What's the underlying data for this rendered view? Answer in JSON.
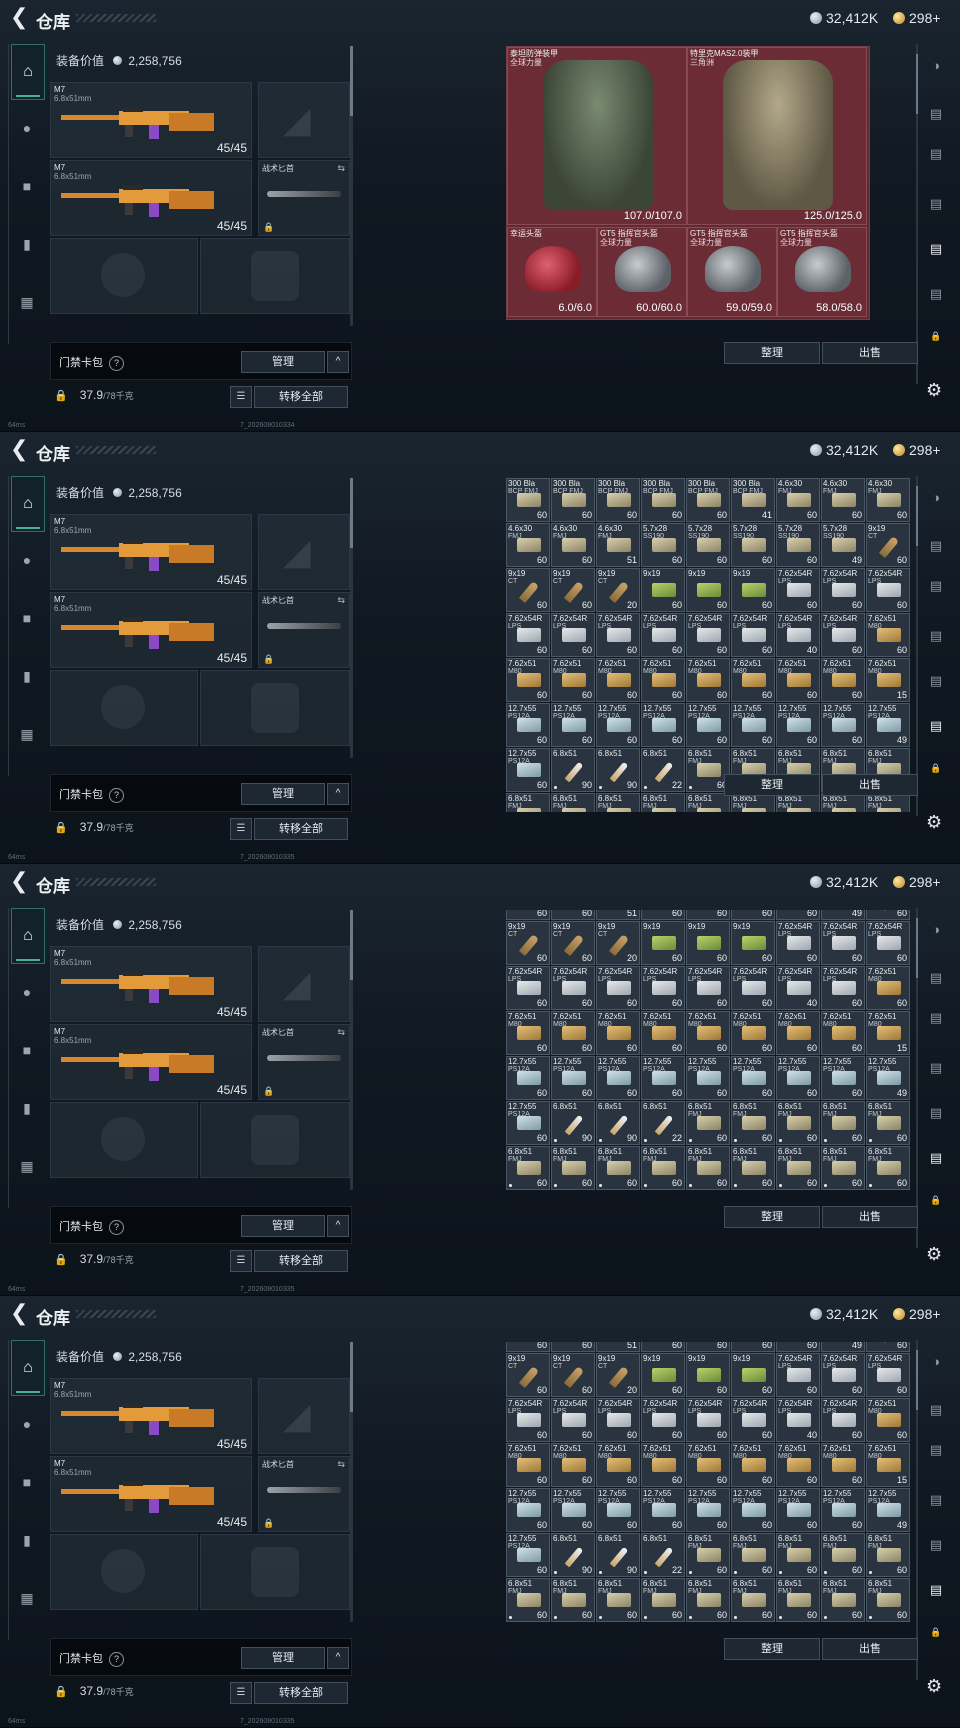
{
  "header": {
    "title": "仓库",
    "silver": "32,412K",
    "gold": "298+"
  },
  "loadout": {
    "equip_value_label": "装备价值",
    "equip_value": "2,258,756",
    "primary1": {
      "name": "M7",
      "caliber": "6.8x51mm",
      "ammo": "45/45"
    },
    "primary2": {
      "name": "M7",
      "caliber": "6.8x51mm",
      "ammo": "45/45"
    },
    "melee": {
      "name": "战术匕首"
    },
    "bag_label": "门禁卡包",
    "help": "?",
    "manage": "管理",
    "weight": "37.9",
    "weight_max": "/78千克",
    "transfer_all": "转移全部"
  },
  "footer": {
    "ping": "64ms",
    "code1": "7_202608010334",
    "code2": "7_202608010335"
  },
  "stash": {
    "sort": "整理",
    "sell": "出售"
  },
  "armor": [
    {
      "name": "泰坦防弹装甲",
      "sub": "全球力量",
      "dur": "107.0/107.0"
    },
    {
      "name": "特里克MAS2.0装甲",
      "sub": "三角洲",
      "dur": "125.0/125.0"
    },
    {
      "name": "幸运头盔",
      "sub": "",
      "dur": "6.0/6.0"
    },
    {
      "name": "GT5 指挥官头盔",
      "sub": "全球力量",
      "dur": "60.0/60.0"
    },
    {
      "name": "GT5 指挥官头盔",
      "sub": "全球力量",
      "dur": "59.0/59.0"
    },
    {
      "name": "GT5 指挥官头盔",
      "sub": "全球力量",
      "dur": "58.0/58.0"
    }
  ],
  "ammo_rows": [
    [
      [
        "300 Bla",
        "BCP FMJ",
        "60",
        "beige"
      ],
      [
        "300 Bla",
        "BCP FMJ",
        "60",
        "beige"
      ],
      [
        "300 Bla",
        "BCP FMJ",
        "60",
        "beige"
      ],
      [
        "300 Bla",
        "BCP FMJ",
        "60",
        "beige"
      ],
      [
        "300 Bla",
        "BCP FMJ",
        "60",
        "beige"
      ],
      [
        "300 Bla",
        "BCP FMJ",
        "41",
        "beige"
      ],
      [
        "4.6x30",
        "FMJ",
        "60",
        "beige"
      ],
      [
        "4.6x30",
        "FMJ",
        "60",
        "beige"
      ],
      [
        "4.6x30",
        "FMJ",
        "60",
        "beige"
      ]
    ],
    [
      [
        "4.6x30",
        "FMJ",
        "60",
        "beige"
      ],
      [
        "4.6x30",
        "FMJ",
        "60",
        "beige"
      ],
      [
        "4.6x30",
        "FMJ",
        "51",
        "beige"
      ],
      [
        "5.7x28",
        "SS190",
        "60",
        "beige"
      ],
      [
        "5.7x28",
        "SS190",
        "60",
        "beige"
      ],
      [
        "5.7x28",
        "SS190",
        "60",
        "beige"
      ],
      [
        "5.7x28",
        "SS190",
        "60",
        "beige"
      ],
      [
        "5.7x28",
        "SS190",
        "49",
        "beige"
      ],
      [
        "9x19",
        "CT",
        "60",
        "shell"
      ]
    ],
    [
      [
        "9x19",
        "CT",
        "60",
        "shell"
      ],
      [
        "9x19",
        "CT",
        "60",
        "shell"
      ],
      [
        "9x19",
        "CT",
        "20",
        "shell"
      ],
      [
        "9x19",
        "",
        "60",
        "green"
      ],
      [
        "9x19",
        "",
        "60",
        "green"
      ],
      [
        "9x19",
        "",
        "60",
        "green"
      ],
      [
        "7.62x54R",
        "LPS",
        "60",
        "white"
      ],
      [
        "7.62x54R",
        "LPS",
        "60",
        "white"
      ],
      [
        "7.62x54R",
        "LPS",
        "60",
        "white"
      ]
    ],
    [
      [
        "7.62x54R",
        "LPS",
        "60",
        "white"
      ],
      [
        "7.62x54R",
        "LPS",
        "60",
        "white"
      ],
      [
        "7.62x54R",
        "LPS",
        "60",
        "white"
      ],
      [
        "7.62x54R",
        "LPS",
        "60",
        "white"
      ],
      [
        "7.62x54R",
        "LPS",
        "60",
        "white"
      ],
      [
        "7.62x54R",
        "LPS",
        "60",
        "white"
      ],
      [
        "7.62x54R",
        "LPS",
        "40",
        "white"
      ],
      [
        "7.62x54R",
        "LPS",
        "60",
        "white"
      ],
      [
        "7.62x51",
        "M80",
        "60",
        "tan"
      ]
    ],
    [
      [
        "7.62x51",
        "M80",
        "60",
        "tan"
      ],
      [
        "7.62x51",
        "M80",
        "60",
        "tan"
      ],
      [
        "7.62x51",
        "M80",
        "60",
        "tan"
      ],
      [
        "7.62x51",
        "M80",
        "60",
        "tan"
      ],
      [
        "7.62x51",
        "M80",
        "60",
        "tan"
      ],
      [
        "7.62x51",
        "M80",
        "60",
        "tan"
      ],
      [
        "7.62x51",
        "M80",
        "60",
        "tan"
      ],
      [
        "7.62x51",
        "M80",
        "60",
        "tan"
      ],
      [
        "7.62x51",
        "M80",
        "15",
        "tan"
      ]
    ],
    [
      [
        "12.7x55",
        "PS12A",
        "60",
        "cyan"
      ],
      [
        "12.7x55",
        "PS12A",
        "60",
        "cyan"
      ],
      [
        "12.7x55",
        "PS12A",
        "60",
        "cyan"
      ],
      [
        "12.7x55",
        "PS12A",
        "60",
        "cyan"
      ],
      [
        "12.7x55",
        "PS12A",
        "60",
        "cyan"
      ],
      [
        "12.7x55",
        "PS12A",
        "60",
        "cyan"
      ],
      [
        "12.7x55",
        "PS12A",
        "60",
        "cyan"
      ],
      [
        "12.7x55",
        "PS12A",
        "60",
        "cyan"
      ],
      [
        "12.7x55",
        "PS12A",
        "49",
        "cyan"
      ]
    ],
    [
      [
        "12.7x55",
        "PS12A",
        "60",
        "cyan"
      ],
      [
        "6.8x51",
        "",
        "90",
        "cart"
      ],
      [
        "6.8x51",
        "",
        "90",
        "cart"
      ],
      [
        "6.8x51",
        "",
        "22",
        "cart"
      ],
      [
        "6.8x51",
        "FMJ",
        "60",
        "beige"
      ],
      [
        "6.8x51",
        "FMJ",
        "60",
        "beige"
      ],
      [
        "6.8x51",
        "FMJ",
        "60",
        "beige"
      ],
      [
        "6.8x51",
        "FMJ",
        "60",
        "beige"
      ],
      [
        "6.8x51",
        "FMJ",
        "60",
        "beige"
      ]
    ],
    [
      [
        "6.8x51",
        "FMJ",
        "60",
        "beige"
      ],
      [
        "6.8x51",
        "FMJ",
        "60",
        "beige"
      ],
      [
        "6.8x51",
        "FMJ",
        "60",
        "beige"
      ],
      [
        "6.8x51",
        "FMJ",
        "60",
        "beige"
      ],
      [
        "6.8x51",
        "FMJ",
        "60",
        "beige"
      ],
      [
        "6.8x51",
        "FMJ",
        "60",
        "beige"
      ],
      [
        "6.8x51",
        "FMJ",
        "60",
        "beige"
      ],
      [
        "6.8x51",
        "FMJ",
        "60",
        "beige"
      ],
      [
        "6.8x51",
        "FMJ",
        "60",
        "beige"
      ]
    ]
  ]
}
